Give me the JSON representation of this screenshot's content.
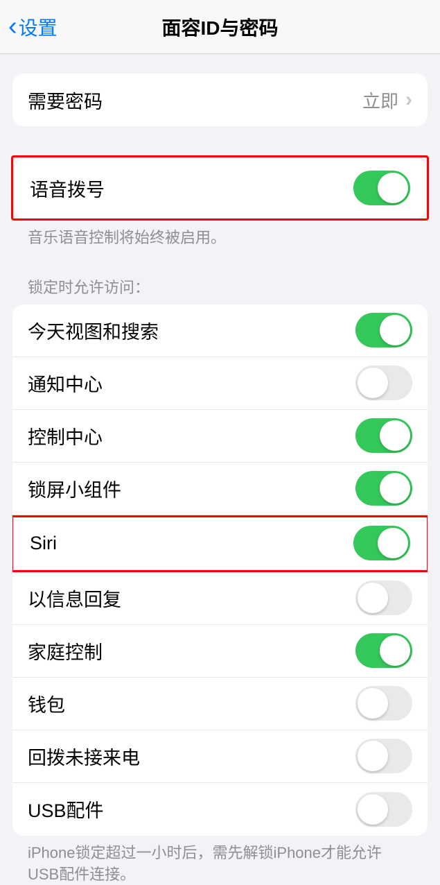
{
  "header": {
    "back_label": "设置",
    "title": "面容ID与密码"
  },
  "require_passcode": {
    "label": "需要密码",
    "value": "立即"
  },
  "voice_dial": {
    "label": "语音拨号",
    "footer": "音乐语音控制将始终被启用。"
  },
  "locked_access": {
    "header": "锁定时允许访问：",
    "items": [
      {
        "label": "今天视图和搜索",
        "on": true
      },
      {
        "label": "通知中心",
        "on": false
      },
      {
        "label": "控制中心",
        "on": true
      },
      {
        "label": "锁屏小组件",
        "on": true
      },
      {
        "label": "Siri",
        "on": true
      },
      {
        "label": "以信息回复",
        "on": false
      },
      {
        "label": "家庭控制",
        "on": true
      },
      {
        "label": "钱包",
        "on": false
      },
      {
        "label": "回拨未接来电",
        "on": false
      },
      {
        "label": "USB配件",
        "on": false
      }
    ],
    "footer": "iPhone锁定超过一小时后，需先解锁iPhone才能允许USB配件连接。"
  }
}
